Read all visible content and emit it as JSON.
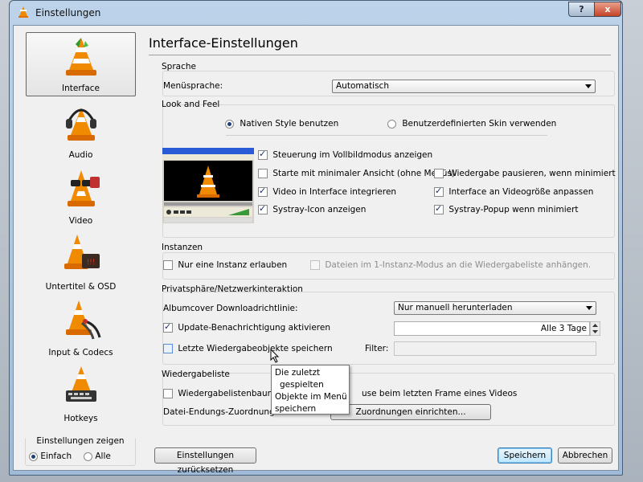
{
  "window": {
    "title": "Einstellungen",
    "help_label": "?",
    "close_label": "x"
  },
  "sidebar": {
    "items": [
      {
        "label": "Interface",
        "icon": "vlc-cone-icon",
        "selected": true
      },
      {
        "label": "Audio",
        "icon": "headphones-cone-icon"
      },
      {
        "label": "Video",
        "icon": "glasses-cone-icon"
      },
      {
        "label": "Untertitel & OSD",
        "icon": "subtitle-cone-icon"
      },
      {
        "label": "Input & Codecs",
        "icon": "cables-cone-icon"
      },
      {
        "label": "Hotkeys",
        "icon": "keyboard-cone-icon"
      }
    ],
    "show_settings": {
      "title": "Einstellungen zeigen",
      "simple": "Einfach",
      "all": "Alle"
    }
  },
  "page": {
    "title": "Interface-Einstellungen"
  },
  "language": {
    "group": "Sprache",
    "label": "Menüsprache:",
    "value": "Automatisch"
  },
  "look": {
    "group": "Look and Feel",
    "native": "Nativen Style benutzen",
    "custom": "Benutzerdefinierten Skin verwenden",
    "fullscreen_controls": "Steuerung im Vollbildmodus anzeigen",
    "minimal_view": "Starte mit minimaler Ansicht (ohne Menüs)",
    "pause_minimized": "Wiedergabe pausieren, wenn minimiert",
    "embed_video": "Video in Interface integrieren",
    "resize_interface": "Interface an Videogröße anpassen",
    "systray_icon": "Systray-Icon anzeigen",
    "systray_popup": "Systray-Popup wenn minimiert"
  },
  "instances": {
    "group": "Instanzen",
    "one_instance": "Nur eine Instanz erlauben",
    "enqueue": "Dateien im 1-Instanz-Modus an die Wiedergabeliste anhängen."
  },
  "privacy": {
    "group": "Privatsphäre/Netzwerkinteraktion",
    "album_label": "Albumcover Downloadrichtlinie:",
    "album_value": "Nur manuell herunterladen",
    "update_notify": "Update-Benachrichtigung aktivieren",
    "update_interval": "Alle 3 Tage",
    "save_recent": "Letzte Wiedergabeobjekte speichern",
    "filter_label": "Filter:"
  },
  "playlist": {
    "group": "Wiedergabeliste",
    "tree_prefix": "Wiedergabelistenbaum anz",
    "pause_suffix": "use beim letzten Frame eines Videos",
    "assoc_label": "Datei-Endungs-Zuordnung",
    "assoc_button": "Zuordnungen einrichten..."
  },
  "tooltip": {
    "lines": [
      "Die zuletzt",
      "gespielten",
      "Objekte im Menü",
      "speichern"
    ]
  },
  "buttons": {
    "reset": "Einstellungen zurücksetzen",
    "save": "Speichern",
    "cancel": "Abbrechen"
  }
}
